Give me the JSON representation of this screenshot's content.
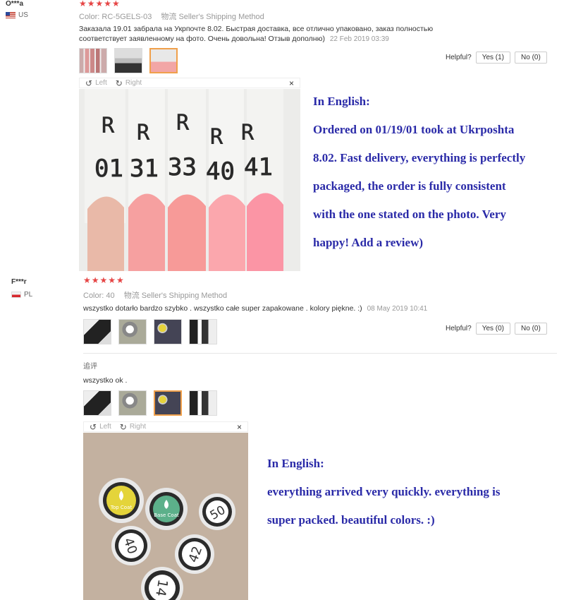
{
  "reviews": [
    {
      "user": "O***a",
      "country": "US",
      "stars": "★★★★★",
      "color_label": "Color:",
      "color_value": "RC-5GELS-03",
      "shipping_label": "物流",
      "shipping_value": "Seller's Shipping Method",
      "text": "Заказала 19.01 забрала на Укрпочте 8.02. Быстрая доставка, все отлично упаковано, заказ полностью соответствует заявленному на фото. Очень довольна! Отзыв дополню)",
      "date": "22 Feb 2019 03:39",
      "helpful_label": "Helpful?",
      "yes_label": "Yes (1)",
      "no_label": "No (0)",
      "viewer": {
        "left": "Left",
        "right": "Right",
        "close": "×"
      },
      "photo_labels": [
        "R",
        "R",
        "R",
        "R",
        "R",
        "01",
        "31",
        "33",
        "40",
        "41"
      ],
      "translation_heading": "In English:",
      "translation_lines": [
        "Ordered on 01/19/01 took at Ukrposhta",
        "8.02. Fast delivery, everything is perfectly",
        "packaged, the order is fully consistent",
        "with the one stated on the photo. Very",
        "happy! Add a review)"
      ]
    },
    {
      "user": "F***r",
      "country": "PL",
      "stars": "★★★★★",
      "color_label": "Color:",
      "color_value": "40",
      "shipping_label": "物流",
      "shipping_value": "Seller's Shipping Method",
      "text": "wszystko dotarło bardzo szybko . wszystko całe super zapakowane . kolory piękne. :)",
      "date": "08 May 2019 10:41",
      "helpful_label": "Helpful?",
      "yes_label": "Yes (0)",
      "no_label": "No (0)",
      "followup_label": "追评",
      "followup_text": "wszystko ok .",
      "viewer": {
        "left": "Left",
        "right": "Right",
        "close": "×"
      },
      "photo_labels": {
        "top": "Top Coat",
        "base": "Base Coat",
        "n50": "50",
        "n40": "40",
        "n42": "42",
        "n14": "14"
      },
      "translation_heading": "In English:",
      "translation_lines": [
        "everything arrived very quickly. everything is",
        "super packed. beautiful colors. :)"
      ]
    }
  ]
}
